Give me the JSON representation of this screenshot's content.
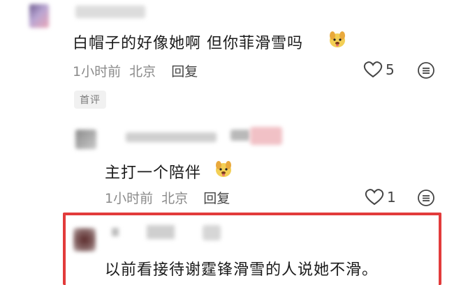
{
  "comments": [
    {
      "text": "白帽子的好像她啊 但你菲滑雪吗",
      "time": "1小时前",
      "location": "北京",
      "reply_label": "回复",
      "like_count": "5",
      "badge": "首评",
      "emoji": "dog-face-emoji"
    },
    {
      "text": "主打一个陪伴",
      "time": "1小时前",
      "location": "北京",
      "reply_label": "回复",
      "like_count": "1",
      "emoji": "dog-face-emoji"
    },
    {
      "text": "以前看接待谢霆锋滑雪的人说她不滑。"
    }
  ],
  "icons": {
    "like": "heart-outline-icon",
    "more": "more-options-icon"
  },
  "colors": {
    "highlight_border": "#e23b3b",
    "meta_text": "#8a8a8a",
    "badge_bg": "#f1f1f1"
  }
}
